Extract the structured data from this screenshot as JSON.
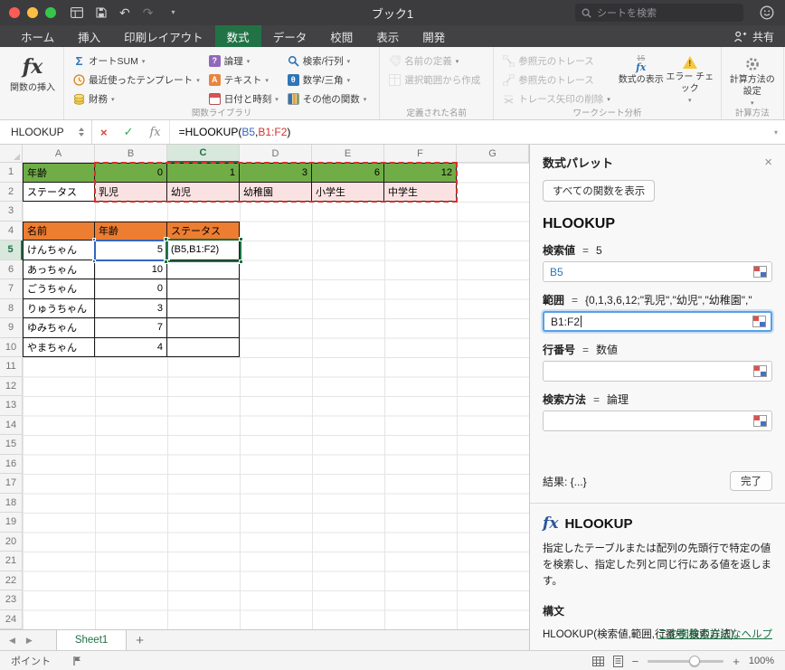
{
  "titlebar": {
    "title": "ブック1",
    "search_placeholder": "シートを検索"
  },
  "tab_bar": {
    "tabs": [
      {
        "id": "home",
        "label": "ホーム",
        "active": false
      },
      {
        "id": "insert",
        "label": "挿入",
        "active": false
      },
      {
        "id": "page-layout",
        "label": "印刷レイアウト",
        "active": false
      },
      {
        "id": "formulas",
        "label": "数式",
        "active": true
      },
      {
        "id": "data",
        "label": "データ",
        "active": false
      },
      {
        "id": "review",
        "label": "校閲",
        "active": false
      },
      {
        "id": "view",
        "label": "表示",
        "active": false
      },
      {
        "id": "developer",
        "label": "開発",
        "active": false
      }
    ],
    "share_label": "共有"
  },
  "ribbon": {
    "insert_function": "関数の挿入",
    "autosum": "オートSUM",
    "recent_templates": "最近使ったテンプレート",
    "financial": "財務",
    "logical": "論理",
    "text": "テキスト",
    "date_time": "日付と時刻",
    "lookup_reference": "検索/行列",
    "math_trig": "数学/三角",
    "more_functions": "その他の関数",
    "define_name": "名前の定義",
    "create_from_selection": "選択範囲から作成",
    "trace_precedents": "参照元のトレース",
    "trace_dependents": "参照先のトレース",
    "remove_arrows": "トレース矢印の削除",
    "show_formulas": "数式の表示",
    "error_checking": "エラー チェック",
    "calculation_options": "計算方法の設定",
    "group_labels": {
      "library": "関数ライブラリ",
      "defined_names": "定義された名前",
      "auditing": "ワークシート分析",
      "calculation": "計算方法"
    }
  },
  "formula_bar": {
    "name_box": "HLOOKUP",
    "segments": [
      {
        "text": "=HLOOKUP(",
        "color": "#000000"
      },
      {
        "text": "B5",
        "color": "#3565c0"
      },
      {
        "text": ",",
        "color": "#000000"
      },
      {
        "text": "B1:F2",
        "color": "#d0342c"
      },
      {
        "text": ")",
        "color": "#000000"
      }
    ]
  },
  "grid": {
    "columns": [
      "A",
      "B",
      "C",
      "D",
      "E",
      "F",
      "G"
    ],
    "row_count": 24,
    "active_column": "C",
    "active_row": 5,
    "fills": {
      "green": "#70ad47",
      "pink": "#fbe2e2",
      "orange": "#ed7d31"
    },
    "cells": [
      {
        "ref": "A1",
        "t": "年齢",
        "f": "green",
        "b": "tlrb"
      },
      {
        "ref": "B1",
        "t": "0",
        "f": "green",
        "a": "r",
        "b": "trb"
      },
      {
        "ref": "C1",
        "t": "1",
        "f": "green",
        "a": "r",
        "b": "trb"
      },
      {
        "ref": "D1",
        "t": "3",
        "f": "green",
        "a": "r",
        "b": "trb"
      },
      {
        "ref": "E1",
        "t": "6",
        "f": "green",
        "a": "r",
        "b": "trb"
      },
      {
        "ref": "F1",
        "t": "12",
        "f": "green",
        "a": "r",
        "b": "trb"
      },
      {
        "ref": "A2",
        "t": "ステータス",
        "b": "lrb"
      },
      {
        "ref": "B2",
        "t": "乳児",
        "f": "pink",
        "b": "rb"
      },
      {
        "ref": "C2",
        "t": "幼児",
        "f": "pink",
        "b": "rb"
      },
      {
        "ref": "D2",
        "t": "幼稚園",
        "f": "pink",
        "b": "rb"
      },
      {
        "ref": "E2",
        "t": "小学生",
        "f": "pink",
        "b": "rb"
      },
      {
        "ref": "F2",
        "t": "中学生",
        "f": "pink",
        "b": "rb"
      },
      {
        "ref": "A4",
        "t": "名前",
        "f": "orange",
        "b": "tlrb"
      },
      {
        "ref": "B4",
        "t": "年齢",
        "f": "orange",
        "b": "trb"
      },
      {
        "ref": "C4",
        "t": "ステータス",
        "f": "orange",
        "b": "trb"
      },
      {
        "ref": "A5",
        "t": "けんちゃん",
        "b": "lrb"
      },
      {
        "ref": "B5",
        "t": "5",
        "a": "r",
        "b": "rb"
      },
      {
        "ref": "C5",
        "t": "(B5,B1:F2)",
        "b": "rb"
      },
      {
        "ref": "A6",
        "t": "あっちゃん",
        "b": "lrb"
      },
      {
        "ref": "B6",
        "t": "10",
        "a": "r",
        "b": "rb"
      },
      {
        "ref": "C6",
        "t": "",
        "b": "rb"
      },
      {
        "ref": "A7",
        "t": "ごうちゃん",
        "b": "lrb"
      },
      {
        "ref": "B7",
        "t": "0",
        "a": "r",
        "b": "rb"
      },
      {
        "ref": "C7",
        "t": "",
        "b": "rb"
      },
      {
        "ref": "A8",
        "t": "りゅうちゃん",
        "b": "lrb"
      },
      {
        "ref": "B8",
        "t": "3",
        "a": "r",
        "b": "rb"
      },
      {
        "ref": "C8",
        "t": "",
        "b": "rb"
      },
      {
        "ref": "A9",
        "t": "ゆみちゃん",
        "b": "lrb"
      },
      {
        "ref": "B9",
        "t": "7",
        "a": "r",
        "b": "rb"
      },
      {
        "ref": "C9",
        "t": "",
        "b": "rb"
      },
      {
        "ref": "A10",
        "t": "やまちゃん",
        "b": "lrb"
      },
      {
        "ref": "B10",
        "t": "4",
        "a": "r",
        "b": "rb"
      },
      {
        "ref": "C10",
        "t": "",
        "b": "rb"
      }
    ],
    "overlays": {
      "red_dashed_range": "B1:F2",
      "blue_ref_cell": "B5",
      "active_cell": "C5"
    }
  },
  "panel": {
    "title": "数式パレット",
    "show_all_functions": "すべての関数を表示",
    "function_name": "HLOOKUP",
    "fields": [
      {
        "id": "lookup_value",
        "label": "検索値",
        "equals": "=",
        "hint": "5",
        "value": "B5",
        "value_color": "#2e75b6",
        "focused": false
      },
      {
        "id": "range",
        "label": "範囲",
        "equals": "=",
        "hint": "{0,1,3,6,12;\"乳児\",\"幼児\",\"幼稚園\",\"小…",
        "value": "B1:F2",
        "value_color": "#222222",
        "focused": true
      },
      {
        "id": "row_number",
        "label": "行番号",
        "equals": "=",
        "hint": "数値",
        "value": "",
        "value_color": "#222222",
        "focused": false
      },
      {
        "id": "search_type",
        "label": "検索方法",
        "equals": "=",
        "hint": "論理",
        "value": "",
        "value_color": "#222222",
        "focused": false
      }
    ],
    "result": "結果: {...}",
    "done_button": "完了",
    "help_title": "HLOOKUP",
    "description": "指定したテーブルまたは配列の先頭行で特定の値を検索し、指定した列と同じ行にある値を返します。",
    "syntax_label": "構文",
    "syntax": "HLOOKUP(検索値,範囲,行番号,検索方法)",
    "help_link": "この関数の詳細なヘルプ"
  },
  "sheet_bar": {
    "tabs": [
      {
        "label": "Sheet1",
        "active": true
      }
    ],
    "add_label": "+"
  },
  "status_bar": {
    "mode": "ポイント",
    "zoom": "100%"
  }
}
